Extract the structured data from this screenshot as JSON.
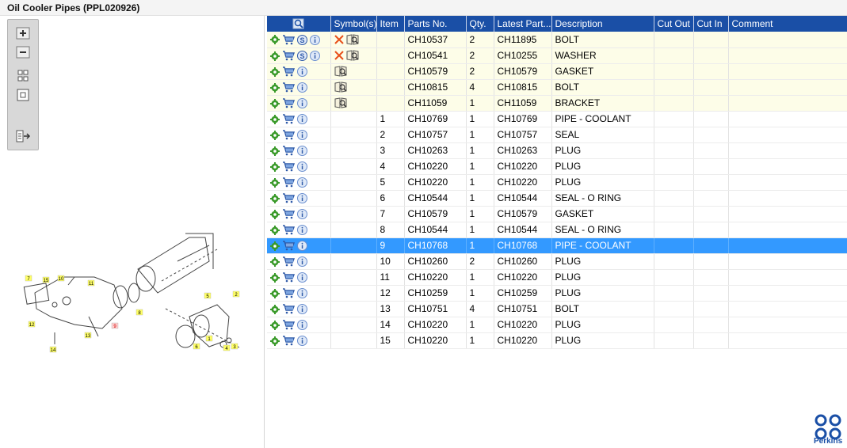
{
  "window": {
    "title": "Oil Cooler Pipes (PPL020926)"
  },
  "toolbar": {
    "buttons": [
      {
        "name": "zoom-in-button",
        "icon": "plus-icon"
      },
      {
        "name": "zoom-out-button",
        "icon": "minus-icon"
      },
      {
        "name": "fit-all-button",
        "icon": "four-squares-icon"
      },
      {
        "name": "fit-window-button",
        "icon": "square-icon"
      },
      {
        "name": "export-button",
        "icon": "list-arrow-icon"
      }
    ]
  },
  "drawing": {
    "callouts": [
      "7",
      "15",
      "10",
      "11",
      "5",
      "2",
      "12",
      "13",
      "9",
      "8",
      "6",
      "1",
      "4",
      "3",
      "14"
    ]
  },
  "grid": {
    "columns": [
      "",
      "Symbol(s)",
      "Item",
      "Parts No.",
      "Qty.",
      "Latest Part...",
      "Description",
      "Cut Out",
      "Cut In",
      "Comment"
    ],
    "rows": [
      {
        "s_badge": true,
        "symbols": "x-book",
        "item": "",
        "part": "CH10537",
        "qty": "2",
        "latest": "CH11895",
        "desc": "BOLT",
        "cut_out": "",
        "cut_in": "",
        "comment": "",
        "kind": "hdr"
      },
      {
        "s_badge": true,
        "symbols": "x-book",
        "item": "",
        "part": "CH10541",
        "qty": "2",
        "latest": "CH10255",
        "desc": "WASHER",
        "cut_out": "",
        "cut_in": "",
        "comment": "",
        "kind": "hdr"
      },
      {
        "s_badge": false,
        "symbols": "book",
        "item": "",
        "part": "CH10579",
        "qty": "2",
        "latest": "CH10579",
        "desc": "GASKET",
        "cut_out": "",
        "cut_in": "",
        "comment": "",
        "kind": "hdr"
      },
      {
        "s_badge": false,
        "symbols": "book",
        "item": "",
        "part": "CH10815",
        "qty": "4",
        "latest": "CH10815",
        "desc": "BOLT",
        "cut_out": "",
        "cut_in": "",
        "comment": "",
        "kind": "hdr"
      },
      {
        "s_badge": false,
        "symbols": "book",
        "item": "",
        "part": "CH11059",
        "qty": "1",
        "latest": "CH11059",
        "desc": "BRACKET",
        "cut_out": "",
        "cut_in": "",
        "comment": "",
        "kind": "hdr"
      },
      {
        "s_badge": false,
        "symbols": "",
        "item": "1",
        "part": "CH10769",
        "qty": "1",
        "latest": "CH10769",
        "desc": "PIPE - COOLANT",
        "cut_out": "",
        "cut_in": "",
        "comment": "",
        "kind": "normal"
      },
      {
        "s_badge": false,
        "symbols": "",
        "item": "2",
        "part": "CH10757",
        "qty": "1",
        "latest": "CH10757",
        "desc": "SEAL",
        "cut_out": "",
        "cut_in": "",
        "comment": "",
        "kind": "normal"
      },
      {
        "s_badge": false,
        "symbols": "",
        "item": "3",
        "part": "CH10263",
        "qty": "1",
        "latest": "CH10263",
        "desc": "PLUG",
        "cut_out": "",
        "cut_in": "",
        "comment": "",
        "kind": "normal"
      },
      {
        "s_badge": false,
        "symbols": "",
        "item": "4",
        "part": "CH10220",
        "qty": "1",
        "latest": "CH10220",
        "desc": "PLUG",
        "cut_out": "",
        "cut_in": "",
        "comment": "",
        "kind": "normal"
      },
      {
        "s_badge": false,
        "symbols": "",
        "item": "5",
        "part": "CH10220",
        "qty": "1",
        "latest": "CH10220",
        "desc": "PLUG",
        "cut_out": "",
        "cut_in": "",
        "comment": "",
        "kind": "normal"
      },
      {
        "s_badge": false,
        "symbols": "",
        "item": "6",
        "part": "CH10544",
        "qty": "1",
        "latest": "CH10544",
        "desc": "SEAL - O RING",
        "cut_out": "",
        "cut_in": "",
        "comment": "",
        "kind": "normal"
      },
      {
        "s_badge": false,
        "symbols": "",
        "item": "7",
        "part": "CH10579",
        "qty": "1",
        "latest": "CH10579",
        "desc": "GASKET",
        "cut_out": "",
        "cut_in": "",
        "comment": "",
        "kind": "normal"
      },
      {
        "s_badge": false,
        "symbols": "",
        "item": "8",
        "part": "CH10544",
        "qty": "1",
        "latest": "CH10544",
        "desc": "SEAL - O RING",
        "cut_out": "",
        "cut_in": "",
        "comment": "",
        "kind": "normal"
      },
      {
        "s_badge": false,
        "symbols": "",
        "item": "9",
        "part": "CH10768",
        "qty": "1",
        "latest": "CH10768",
        "desc": "PIPE - COOLANT",
        "cut_out": "",
        "cut_in": "",
        "comment": "",
        "kind": "selected"
      },
      {
        "s_badge": false,
        "symbols": "",
        "item": "10",
        "part": "CH10260",
        "qty": "2",
        "latest": "CH10260",
        "desc": "PLUG",
        "cut_out": "",
        "cut_in": "",
        "comment": "",
        "kind": "normal"
      },
      {
        "s_badge": false,
        "symbols": "",
        "item": "11",
        "part": "CH10220",
        "qty": "1",
        "latest": "CH10220",
        "desc": "PLUG",
        "cut_out": "",
        "cut_in": "",
        "comment": "",
        "kind": "normal"
      },
      {
        "s_badge": false,
        "symbols": "",
        "item": "12",
        "part": "CH10259",
        "qty": "1",
        "latest": "CH10259",
        "desc": "PLUG",
        "cut_out": "",
        "cut_in": "",
        "comment": "",
        "kind": "normal"
      },
      {
        "s_badge": false,
        "symbols": "",
        "item": "13",
        "part": "CH10751",
        "qty": "4",
        "latest": "CH10751",
        "desc": "BOLT",
        "cut_out": "",
        "cut_in": "",
        "comment": "",
        "kind": "normal"
      },
      {
        "s_badge": false,
        "symbols": "",
        "item": "14",
        "part": "CH10220",
        "qty": "1",
        "latest": "CH10220",
        "desc": "PLUG",
        "cut_out": "",
        "cut_in": "",
        "comment": "",
        "kind": "normal"
      },
      {
        "s_badge": false,
        "symbols": "",
        "item": "15",
        "part": "CH10220",
        "qty": "1",
        "latest": "CH10220",
        "desc": "PLUG",
        "cut_out": "",
        "cut_in": "",
        "comment": "",
        "kind": "normal"
      }
    ]
  },
  "brand": {
    "name": "Perkins",
    "color": "#1a4fa6"
  },
  "colors": {
    "header": "#1a4fa6",
    "selected": "#3399ff",
    "highlight_row": "#fdfde8",
    "gear": "#3a9a2a"
  }
}
